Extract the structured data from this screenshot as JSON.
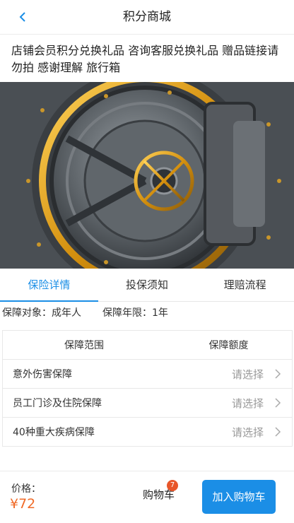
{
  "header": {
    "title": "积分商城",
    "back_icon": "chevron-left-icon",
    "accent": "#1b8ee6"
  },
  "product": {
    "description": "店铺会员积分兑换礼品 咨询客服兑换礼品 赠品链接请勿拍 感谢理解 旅行箱"
  },
  "tabs": [
    {
      "label": "保险详情",
      "active": true
    },
    {
      "label": "投保须知",
      "active": false
    },
    {
      "label": "理赔流程",
      "active": false
    }
  ],
  "info": {
    "target": "保障对象：成年人",
    "term": "保障年限：1年"
  },
  "coverage_table": {
    "headers": [
      "保障范围",
      "保障额度"
    ],
    "rows": [
      {
        "name": "意外伤害保障",
        "select": "请选择"
      },
      {
        "name": "员工门诊及住院保障",
        "select": "请选择"
      },
      {
        "name": "40种重大疾病保障",
        "select": "请选择"
      }
    ]
  },
  "footer": {
    "price_label": "价格：",
    "price": "¥72",
    "cart_label": "购物车",
    "cart_count": "7",
    "add_to_cart": "加入购物车",
    "price_color": "#f06a27",
    "badge_color": "#e8562a"
  }
}
